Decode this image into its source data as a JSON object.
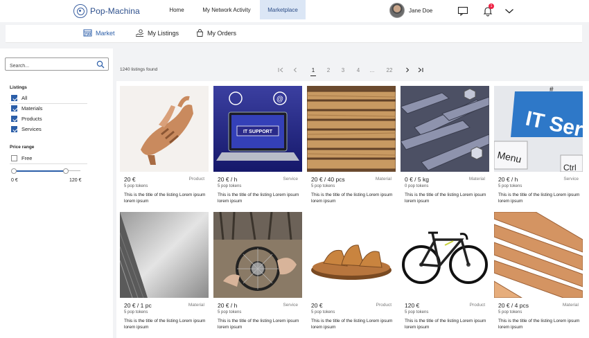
{
  "brand": {
    "name": "Pop-Machina"
  },
  "topnav": {
    "items": [
      {
        "label": "Home"
      },
      {
        "label": "My Network Activity"
      },
      {
        "label": "Marketplace",
        "active": true
      }
    ],
    "user": {
      "name": "Jane Doe"
    },
    "notifications_count": "1",
    "icons": [
      "chat-icon",
      "bell-icon",
      "chevron-down-icon"
    ]
  },
  "subnav": {
    "tabs": [
      {
        "label": "Market",
        "icon": "store-icon",
        "active": true
      },
      {
        "label": "My Listings",
        "icon": "hand-coins-icon"
      },
      {
        "label": "My Orders",
        "icon": "shopping-bag-icon"
      }
    ]
  },
  "sidebar": {
    "search_placeholder": "Search...",
    "listings_title": "Listings",
    "listings_filters": [
      {
        "label": "All",
        "checked": true
      },
      {
        "label": "Materials",
        "checked": true
      },
      {
        "label": "Products",
        "checked": true
      },
      {
        "label": "Services",
        "checked": true
      }
    ],
    "price_title": "Price range",
    "free_label": "Free",
    "free_checked": false,
    "range_min": "0 €",
    "range_max": "120 €"
  },
  "results": {
    "count_text": "1240 listings found",
    "pages": [
      "1",
      "2",
      "3",
      "4",
      "...",
      "22"
    ],
    "current_page": "1"
  },
  "listings": [
    {
      "price": "20 €",
      "type": "Product",
      "tokens": "5 pop tokens",
      "title": "This is the title of the listing Lorem ipsum lorem ipsum",
      "image": "sandal-tan"
    },
    {
      "price": "20 € / h",
      "type": "Service",
      "tokens": "5 pop tokens",
      "title": "This is the title of the listing Lorem ipsum lorem ipsum",
      "image": "it-support-laptop"
    },
    {
      "price": "20 € / 40 pcs",
      "type": "Material",
      "tokens": "5 pop tokens",
      "title": "This is the title of the listing Lorem ipsum lorem ipsum",
      "image": "stacked-lumber"
    },
    {
      "price": "0 € / 5 kg",
      "type": "Material",
      "tokens": "0 pop tokens",
      "title": "This is the title of the listing Lorem ipsum lorem ipsum",
      "image": "steel-bars"
    },
    {
      "price": "20 € / h",
      "type": "Service",
      "tokens": "5 pop tokens",
      "title": "This is the title of the listing Lorem ipsum lorem ipsum",
      "image": "it-services-keyboard"
    },
    {
      "price": "20 € / 1 pc",
      "type": "Material",
      "tokens": "5 pop tokens",
      "title": "This is the title of the listing Lorem ipsum lorem ipsum",
      "image": "metal-sheet"
    },
    {
      "price": "20 € / h",
      "type": "Service",
      "tokens": "5 pop tokens",
      "title": "This is the title of the listing Lorem ipsum lorem ipsum",
      "image": "bicycle-repair"
    },
    {
      "price": "20 €",
      "type": "Product",
      "tokens": "5 pop tokens",
      "title": "This is the title of the listing Lorem ipsum lorem ipsum",
      "image": "leather-sandal"
    },
    {
      "price": "120 €",
      "type": "Product",
      "tokens": "5 pop tokens",
      "title": "This is the title of the listing Lorem ipsum lorem ipsum",
      "image": "road-bike"
    },
    {
      "price": "20 € / 4 pcs",
      "type": "Material",
      "tokens": "5 pop tokens",
      "title": "This is the title of the listing Lorem ipsum lorem ipsum",
      "image": "wood-planks"
    }
  ],
  "image_texts": {
    "it_support": "IT SUPPORT",
    "it_serv": "IT Serv",
    "menu_key": "Menu",
    "ctrl_key": "Ctrl",
    "hash_key": "#"
  },
  "colors": {
    "accent": "#2b5ea8",
    "active_nav_bg": "#dbe6f5",
    "brand": "#2d4f8c"
  }
}
